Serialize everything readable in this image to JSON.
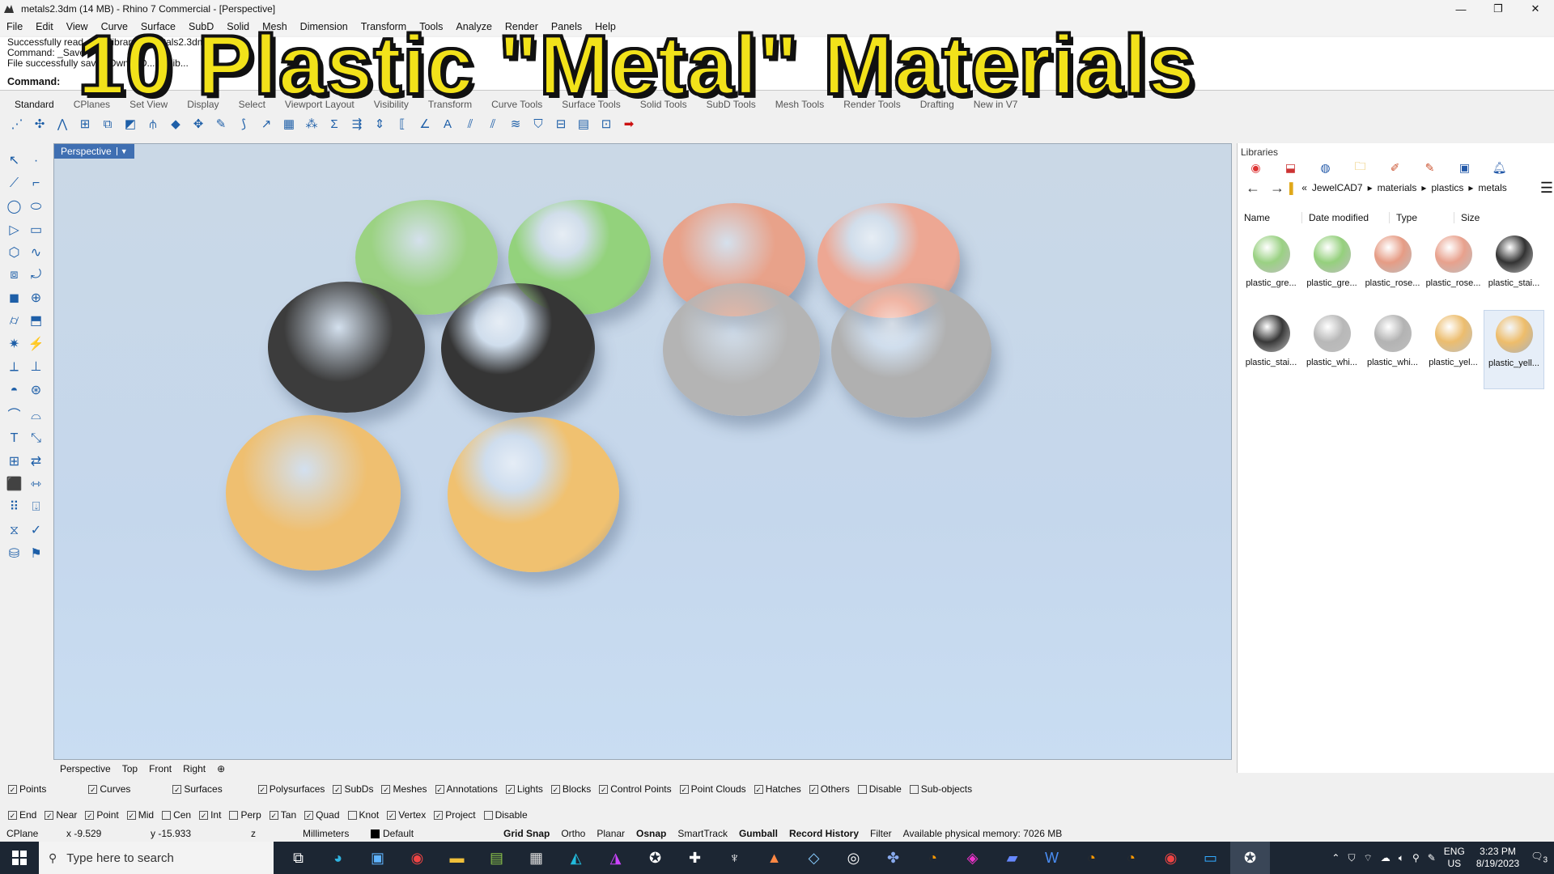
{
  "window": {
    "title": "metals2.3dm (14 MB) - Rhino 7 Commercial - [Perspective]",
    "controls": [
      "—",
      "❐",
      "✕"
    ]
  },
  "menu": [
    "File",
    "Edit",
    "View",
    "Curve",
    "Surface",
    "SubD",
    "Solid",
    "Mesh",
    "Dimension",
    "Transform",
    "Tools",
    "Analyze",
    "Render",
    "Panels",
    "Help"
  ],
  "command": {
    "history": [
      "Successfully read ... ds\\library ... metals2.3dm\"",
      "Command: _Save",
      "File successfully sav... \\Owner\\D... ds\\lib..."
    ],
    "prompt": "Command:"
  },
  "toolbar_tabs": [
    "Standard",
    "CPlanes",
    "Set View",
    "Display",
    "Select",
    "Viewport Layout",
    "Visibility",
    "Transform",
    "Curve Tools",
    "Surface Tools",
    "Solid Tools",
    "SubD Tools",
    "Mesh Tools",
    "Render Tools",
    "Drafting",
    "New in V7"
  ],
  "overlay": {
    "headline": "10 Plastic \"Metal\" Materials"
  },
  "viewport": {
    "label": "Perspective",
    "tabs": [
      "Perspective",
      "Top",
      "Front",
      "Right",
      "⊕"
    ]
  },
  "spheres": [
    {
      "name": "green-matte",
      "color": "#9bd282"
    },
    {
      "name": "green-glossy",
      "color": "#93d27c"
    },
    {
      "name": "rose-matte",
      "color": "#e8a28a"
    },
    {
      "name": "rose-glossy",
      "color": "#eda793"
    },
    {
      "name": "stainless-matte",
      "color": "#3c3c3c"
    },
    {
      "name": "stainless-glossy",
      "color": "#353535"
    },
    {
      "name": "white-matte",
      "color": "#b4b4b4"
    },
    {
      "name": "white-glossy",
      "color": "#b0b0b0"
    },
    {
      "name": "yellow-matte",
      "color": "#efbf70"
    },
    {
      "name": "yellow-glossy",
      "color": "#f0c170"
    }
  ],
  "libraries": {
    "title": "Libraries",
    "breadcrumb": [
      "«",
      "JewelCAD7",
      "▸",
      "materials",
      "▸",
      "plastics",
      "▸",
      "metals"
    ],
    "columns": [
      "Name",
      "Date modified",
      "Type",
      "Size"
    ],
    "items": [
      {
        "label": "plastic_gre...",
        "color": "#9ad183"
      },
      {
        "label": "plastic_gre...",
        "color": "#95d07d"
      },
      {
        "label": "plastic_rose...",
        "color": "#e69c85"
      },
      {
        "label": "plastic_rose...",
        "color": "#e8a18d"
      },
      {
        "label": "plastic_stai...",
        "color": "#333333"
      },
      {
        "label": "plastic_stai...",
        "color": "#383838"
      },
      {
        "label": "plastic_whi...",
        "color": "#b8b8b8"
      },
      {
        "label": "plastic_whi...",
        "color": "#b3b3b3"
      },
      {
        "label": "plastic_yel...",
        "color": "#ecbd6e"
      },
      {
        "label": "plastic_yell...",
        "color": "#eebd6b"
      }
    ]
  },
  "filters": [
    {
      "label": "Points",
      "checked": true
    },
    {
      "label": "Curves",
      "checked": true
    },
    {
      "label": "Surfaces",
      "checked": true
    },
    {
      "label": "Polysurfaces",
      "checked": true
    },
    {
      "label": "SubDs",
      "checked": true
    },
    {
      "label": "Meshes",
      "checked": true
    },
    {
      "label": "Annotations",
      "checked": true
    },
    {
      "label": "Lights",
      "checked": true
    },
    {
      "label": "Blocks",
      "checked": true
    },
    {
      "label": "Control Points",
      "checked": true
    },
    {
      "label": "Point Clouds",
      "checked": true
    },
    {
      "label": "Hatches",
      "checked": true
    },
    {
      "label": "Others",
      "checked": true
    },
    {
      "label": "Disable",
      "checked": false
    },
    {
      "label": "Sub-objects",
      "checked": false
    }
  ],
  "osnaps": [
    {
      "label": "End",
      "checked": true
    },
    {
      "label": "Near",
      "checked": true
    },
    {
      "label": "Point",
      "checked": true
    },
    {
      "label": "Mid",
      "checked": true
    },
    {
      "label": "Cen",
      "checked": false
    },
    {
      "label": "Int",
      "checked": true
    },
    {
      "label": "Perp",
      "checked": false
    },
    {
      "label": "Tan",
      "checked": true
    },
    {
      "label": "Quad",
      "checked": true
    },
    {
      "label": "Knot",
      "checked": false
    },
    {
      "label": "Vertex",
      "checked": true
    },
    {
      "label": "Project",
      "checked": true
    },
    {
      "label": "Disable",
      "checked": false
    }
  ],
  "status": {
    "cplane": "CPlane",
    "x": "x -9.529",
    "y": "y -15.933",
    "z": "z",
    "units": "Millimeters",
    "layer": "Default",
    "toggles": [
      "Grid Snap",
      "Ortho",
      "Planar",
      "Osnap",
      "SmartTrack",
      "Gumball",
      "Record History",
      "Filter"
    ],
    "memory": "Available physical memory: 7026 MB"
  },
  "taskbar": {
    "search_placeholder": "Type here to search",
    "lang": "ENG",
    "region": "US",
    "time": "3:23 PM",
    "date": "8/19/2023",
    "notifications": "3"
  }
}
